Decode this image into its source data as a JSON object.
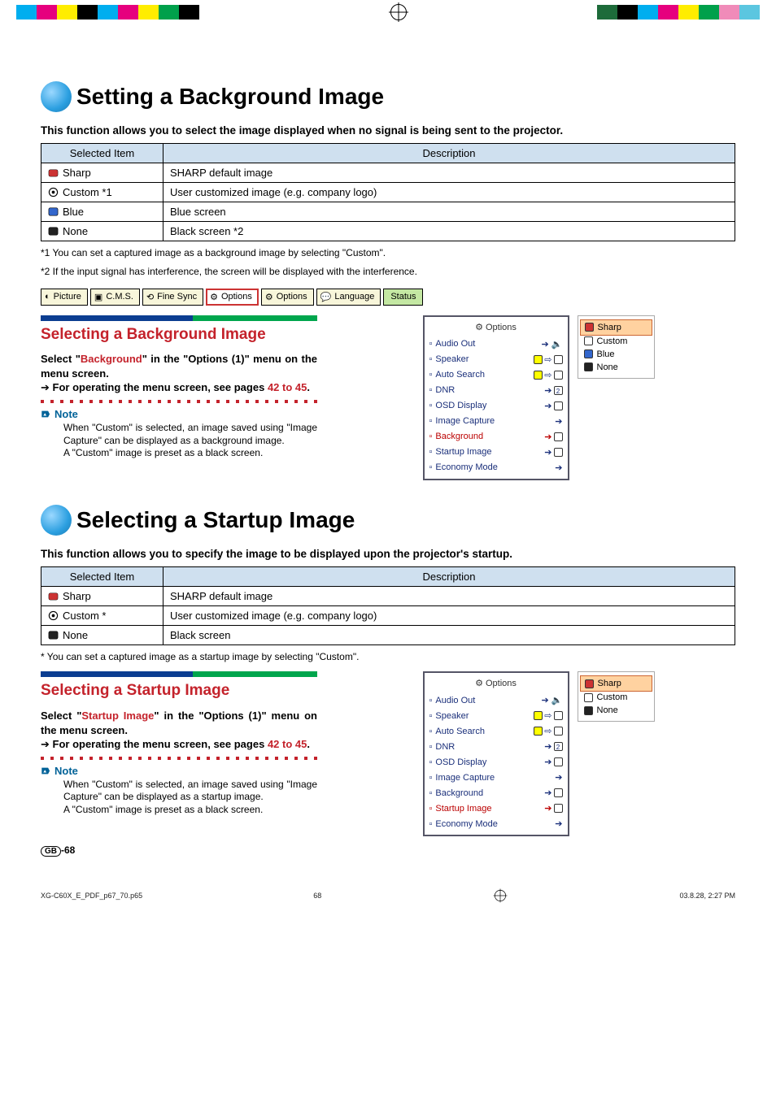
{
  "prepress": {
    "left_bar": [
      "#00aeef",
      "#e6007e",
      "#ffed00",
      "#000000",
      "#00aeef",
      "#e6007e",
      "#ffed00",
      "#00a04b",
      "#000000"
    ],
    "right_bar": [
      "#1d6b3a",
      "#000000",
      "#00aeef",
      "#e6007e",
      "#ffed00",
      "#00a04b",
      "#f08bb9",
      "#5bc6e0"
    ]
  },
  "section1": {
    "title": "Setting a Background Image",
    "lead": "This function allows you to select the image displayed when no signal is being sent to the projector.",
    "table": {
      "head": [
        "Selected Item",
        "Description"
      ],
      "rows": [
        {
          "icon": "logo",
          "item": "Sharp",
          "desc": "SHARP default image"
        },
        {
          "icon": "eye",
          "item": "Custom *1",
          "desc": "User customized image (e.g. company logo)"
        },
        {
          "icon": "blue",
          "item": "Blue",
          "desc": "Blue screen"
        },
        {
          "icon": "black",
          "item": "None",
          "desc": "Black screen *2"
        }
      ]
    },
    "footnotes": [
      "*1 You can set a captured image as a background image by selecting \"Custom\".",
      "*2 If the input signal has interference, the screen will be displayed with the interference."
    ]
  },
  "menubar": {
    "tabs": [
      {
        "icon": "pic",
        "label": "Picture"
      },
      {
        "icon": "cms",
        "label": "C.M.S."
      },
      {
        "icon": "sync",
        "label": "Fine Sync"
      },
      {
        "icon": "opt",
        "label": "Options",
        "selected": true
      },
      {
        "icon": "opt",
        "label": "Options"
      },
      {
        "icon": "lang",
        "label": "Language"
      },
      {
        "icon": "status",
        "label": "Status",
        "status": true
      }
    ]
  },
  "sub1": {
    "heading": "Selecting a Background Image",
    "instr_pre": "Select \"",
    "instr_hl": "Background",
    "instr_post": "\" in the \"Options (1)\" menu on the menu screen.",
    "arrow_line": "For operating the menu screen, see pages ",
    "pages_ref": "42 to 45",
    "note_label": "Note",
    "note_body1": "When \"Custom\" is selected, an image saved using \"Image Capture\" can be displayed as a background image.",
    "note_body2": "A \"Custom\" image is preset as a black screen."
  },
  "osd1": {
    "title": "Options",
    "selected_row": "Background",
    "rows": [
      {
        "label": "Audio Out",
        "ind": "arrow-speaker"
      },
      {
        "label": "Speaker",
        "ind": "toggle"
      },
      {
        "label": "Auto Search",
        "ind": "toggle"
      },
      {
        "label": "DNR",
        "ind": "arrow-num"
      },
      {
        "label": "OSD Display",
        "ind": "arrow-box"
      },
      {
        "label": "Image Capture",
        "ind": "arrow"
      },
      {
        "label": "Background",
        "ind": "arrow-box"
      },
      {
        "label": "Startup Image",
        "ind": "arrow-box"
      },
      {
        "label": "Economy Mode",
        "ind": "arrow"
      }
    ],
    "legend": [
      {
        "icon": "red",
        "label": "Sharp",
        "selected": true
      },
      {
        "icon": "eye",
        "label": "Custom"
      },
      {
        "icon": "blue",
        "label": "Blue"
      },
      {
        "icon": "black",
        "label": "None"
      }
    ]
  },
  "section2": {
    "title": "Selecting a Startup Image",
    "lead": "This function allows you to specify the image to be displayed upon the projector's startup.",
    "table": {
      "head": [
        "Selected Item",
        "Description"
      ],
      "rows": [
        {
          "icon": "logo",
          "item": "Sharp",
          "desc": "SHARP default image"
        },
        {
          "icon": "eye",
          "item": "Custom *",
          "desc": "User customized image (e.g. company logo)"
        },
        {
          "icon": "black",
          "item": "None",
          "desc": "Black screen"
        }
      ]
    },
    "footnote": "* You can set a captured image as a startup image by selecting \"Custom\"."
  },
  "sub2": {
    "heading": "Selecting a Startup Image",
    "instr_pre": "Select \"",
    "instr_hl": "Startup Image",
    "instr_post": "\" in the \"Options (1)\" menu on the menu screen.",
    "arrow_line": "For operating the menu screen, see pages ",
    "pages_ref": "42 to 45",
    "note_label": "Note",
    "note_body1": "When \"Custom\" is selected, an image saved using \"Image Capture\" can be displayed as a startup image.",
    "note_body2": "A \"Custom\" image is preset as a black screen."
  },
  "osd2": {
    "title": "Options",
    "selected_row": "Startup Image",
    "rows": [
      {
        "label": "Audio Out",
        "ind": "arrow-speaker"
      },
      {
        "label": "Speaker",
        "ind": "toggle"
      },
      {
        "label": "Auto Search",
        "ind": "toggle"
      },
      {
        "label": "DNR",
        "ind": "arrow-num"
      },
      {
        "label": "OSD Display",
        "ind": "arrow-box"
      },
      {
        "label": "Image Capture",
        "ind": "arrow"
      },
      {
        "label": "Background",
        "ind": "arrow-box"
      },
      {
        "label": "Startup Image",
        "ind": "arrow-box"
      },
      {
        "label": "Economy Mode",
        "ind": "arrow"
      }
    ],
    "legend": [
      {
        "icon": "red",
        "label": "Sharp",
        "selected": true
      },
      {
        "icon": "eye",
        "label": "Custom"
      },
      {
        "icon": "black",
        "label": "None"
      }
    ]
  },
  "footer": {
    "region": "GB",
    "page": "-68",
    "file": "XG-C60X_E_PDF_p67_70.p65",
    "num": "68",
    "stamp": "03.8.28, 2:27 PM"
  }
}
